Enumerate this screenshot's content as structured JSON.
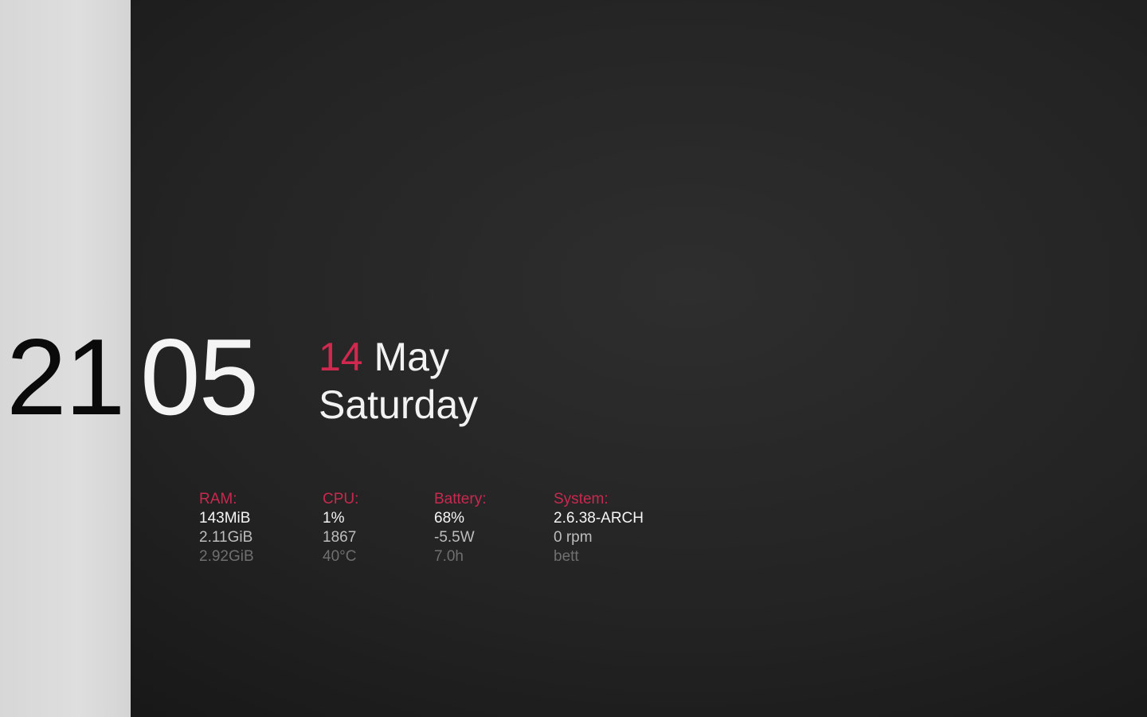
{
  "clock": {
    "hours": "21",
    "minutes": "05"
  },
  "date": {
    "day_number": "14",
    "month": "May",
    "weekday": "Saturday"
  },
  "stats": {
    "ram": {
      "label": "RAM:",
      "values": [
        "143MiB",
        "2.11GiB",
        "2.92GiB"
      ]
    },
    "cpu": {
      "label": "CPU:",
      "values": [
        "1%",
        "1867",
        "40°C"
      ]
    },
    "battery": {
      "label": "Battery:",
      "values": [
        "68%",
        "-5.5W",
        "7.0h"
      ]
    },
    "system": {
      "label": "System:",
      "values": [
        "2.6.38-ARCH",
        "0 rpm",
        "bett"
      ]
    }
  },
  "colors": {
    "accent": "#d0284e",
    "background": "#222222",
    "strip": "#dcdcdc",
    "primary_text": "#f5f5f5",
    "secondary_text": "#bdbdbd",
    "dim_text": "#6f6f6f"
  }
}
